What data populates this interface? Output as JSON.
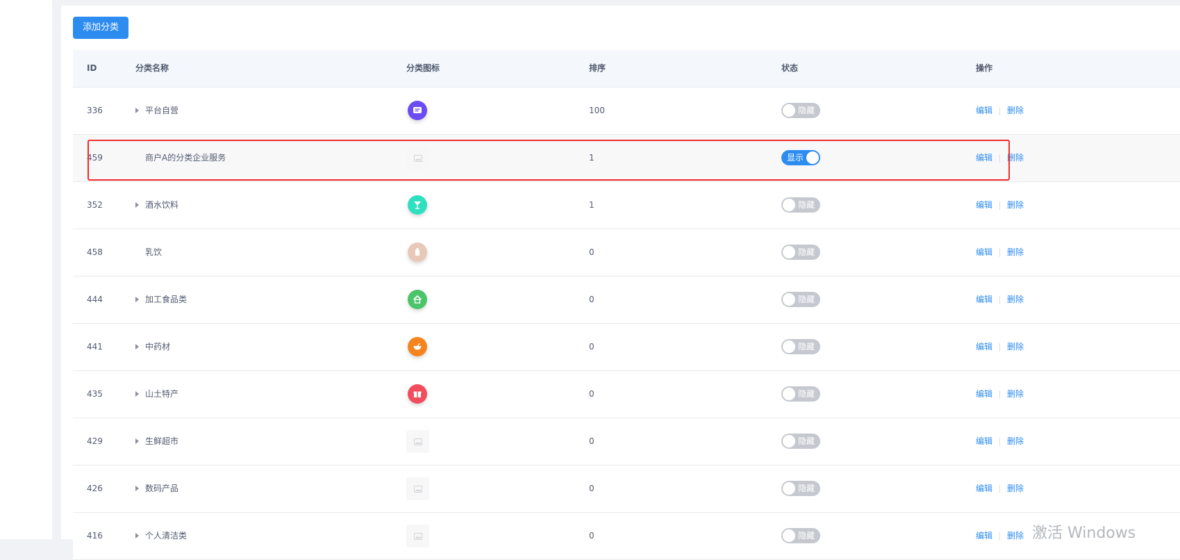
{
  "toolbar": {
    "add_label": "添加分类"
  },
  "table": {
    "columns": [
      "ID",
      "分类名称",
      "分类图标",
      "排序",
      "状态",
      "操作"
    ],
    "rows": [
      {
        "id": "336",
        "name": "平台自营",
        "expandable": true,
        "icon": "chat-icon",
        "icon_color": "#6b4bf2",
        "sort": "100",
        "status": "隐藏",
        "on": false
      },
      {
        "id": "459",
        "name": "商户A的分类企业服务",
        "expandable": false,
        "icon": "image-placeholder-icon",
        "icon_color": "",
        "sort": "1",
        "status": "显示",
        "on": true
      },
      {
        "id": "352",
        "name": "酒水饮料",
        "expandable": true,
        "icon": "cocktail-icon",
        "icon_color": "#2fe0c0",
        "sort": "1",
        "status": "隐藏",
        "on": false
      },
      {
        "id": "458",
        "name": "乳饮",
        "expandable": false,
        "icon": "drink-icon",
        "icon_color": "#e8c9b8",
        "sort": "0",
        "status": "隐藏",
        "on": false
      },
      {
        "id": "444",
        "name": "加工食品类",
        "expandable": true,
        "icon": "house-icon",
        "icon_color": "#4cc46a",
        "sort": "0",
        "status": "隐藏",
        "on": false
      },
      {
        "id": "441",
        "name": "中药材",
        "expandable": true,
        "icon": "bowl-icon",
        "icon_color": "#f5841f",
        "sort": "0",
        "status": "隐藏",
        "on": false
      },
      {
        "id": "435",
        "name": "山土特产",
        "expandable": true,
        "icon": "gift-icon",
        "icon_color": "#f24d5c",
        "sort": "0",
        "status": "隐藏",
        "on": false
      },
      {
        "id": "429",
        "name": "生鲜超市",
        "expandable": true,
        "icon": "image-placeholder-icon",
        "icon_color": "",
        "sort": "0",
        "status": "隐藏",
        "on": false
      },
      {
        "id": "426",
        "name": "数码产品",
        "expandable": true,
        "icon": "image-placeholder-icon",
        "icon_color": "",
        "sort": "0",
        "status": "隐藏",
        "on": false
      },
      {
        "id": "416",
        "name": "个人清洁类",
        "expandable": true,
        "icon": "image-placeholder-icon",
        "icon_color": "",
        "sort": "0",
        "status": "隐藏",
        "on": false
      }
    ],
    "actions": {
      "edit": "编辑",
      "delete": "删除"
    }
  },
  "watermark": "激活 Windows",
  "colors": {
    "primary": "#2d8cf0",
    "highlight": "#ef2b2b",
    "switch_off": "#c5c8ce"
  }
}
